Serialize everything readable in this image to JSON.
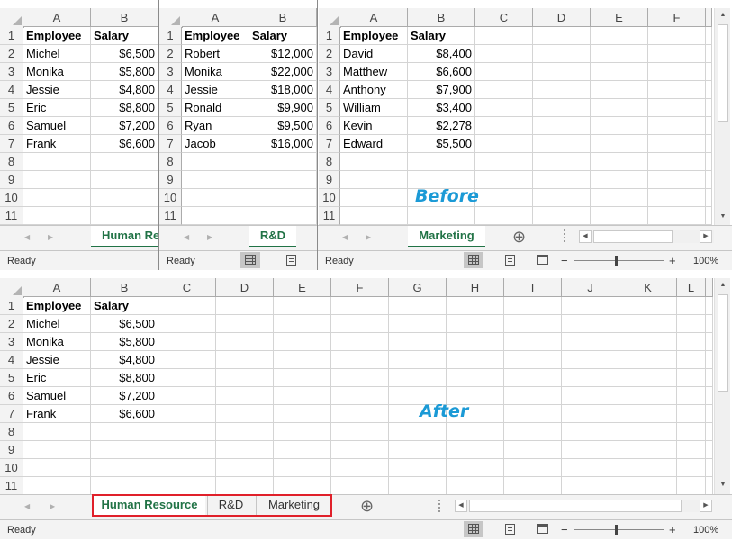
{
  "before": {
    "windows": [
      {
        "name": "human-resource",
        "columns": [
          "A",
          "B"
        ],
        "tab_label": "Human Re",
        "status": "Ready",
        "rows": [
          {
            "n": "1",
            "a": "Employee",
            "b": "Salary"
          },
          {
            "n": "2",
            "a": "Michel",
            "b": "$6,500"
          },
          {
            "n": "3",
            "a": "Monika",
            "b": "$5,800"
          },
          {
            "n": "4",
            "a": "Jessie",
            "b": "$4,800"
          },
          {
            "n": "5",
            "a": "Eric",
            "b": "$8,800"
          },
          {
            "n": "6",
            "a": "Samuel",
            "b": "$7,200"
          },
          {
            "n": "7",
            "a": "Frank",
            "b": "$6,600"
          },
          {
            "n": "8",
            "a": "",
            "b": ""
          },
          {
            "n": "9",
            "a": "",
            "b": ""
          },
          {
            "n": "10",
            "a": "",
            "b": ""
          },
          {
            "n": "11",
            "a": "",
            "b": ""
          }
        ]
      },
      {
        "name": "rd",
        "columns": [
          "A",
          "B"
        ],
        "tab_label": "R&D",
        "status": "Ready",
        "rows": [
          {
            "n": "1",
            "a": "Employee",
            "b": "Salary"
          },
          {
            "n": "2",
            "a": "Robert",
            "b": "$12,000"
          },
          {
            "n": "3",
            "a": "Monika",
            "b": "$22,000"
          },
          {
            "n": "4",
            "a": "Jessie",
            "b": "$18,000"
          },
          {
            "n": "5",
            "a": "Ronald",
            "b": "$9,900"
          },
          {
            "n": "6",
            "a": "Ryan",
            "b": "$9,500"
          },
          {
            "n": "7",
            "a": "Jacob",
            "b": "$16,000"
          },
          {
            "n": "8",
            "a": "",
            "b": ""
          },
          {
            "n": "9",
            "a": "",
            "b": ""
          },
          {
            "n": "10",
            "a": "",
            "b": ""
          },
          {
            "n": "11",
            "a": "",
            "b": ""
          }
        ]
      },
      {
        "name": "marketing",
        "columns": [
          "A",
          "B",
          "C",
          "D",
          "E",
          "F"
        ],
        "tab_label": "Marketing",
        "status": "Ready",
        "zoom": "100%",
        "rows": [
          {
            "n": "1",
            "a": "Employee",
            "b": "Salary"
          },
          {
            "n": "2",
            "a": "David",
            "b": "$8,400"
          },
          {
            "n": "3",
            "a": "Matthew",
            "b": "$6,600"
          },
          {
            "n": "4",
            "a": "Anthony",
            "b": "$7,900"
          },
          {
            "n": "5",
            "a": "William",
            "b": "$3,400"
          },
          {
            "n": "6",
            "a": "Kevin",
            "b": "$2,278"
          },
          {
            "n": "7",
            "a": "Edward",
            "b": "$5,500"
          },
          {
            "n": "8",
            "a": "",
            "b": ""
          },
          {
            "n": "9",
            "a": "",
            "b": ""
          },
          {
            "n": "10",
            "a": "",
            "b": ""
          },
          {
            "n": "11",
            "a": "",
            "b": ""
          }
        ]
      }
    ],
    "label": "Before"
  },
  "after": {
    "label": "After",
    "columns": [
      "A",
      "B",
      "C",
      "D",
      "E",
      "F",
      "G",
      "H",
      "I",
      "J",
      "K",
      "L"
    ],
    "tabs": [
      "Human Resource",
      "R&D",
      "Marketing"
    ],
    "active_tab": "Human Resource",
    "status": "Ready",
    "zoom": "100%",
    "highlight_color": "#e0202a",
    "rows": [
      {
        "n": "1",
        "a": "Employee",
        "b": "Salary"
      },
      {
        "n": "2",
        "a": "Michel",
        "b": "$6,500"
      },
      {
        "n": "3",
        "a": "Monika",
        "b": "$5,800"
      },
      {
        "n": "4",
        "a": "Jessie",
        "b": "$4,800"
      },
      {
        "n": "5",
        "a": "Eric",
        "b": "$8,800"
      },
      {
        "n": "6",
        "a": "Samuel",
        "b": "$7,200"
      },
      {
        "n": "7",
        "a": "Frank",
        "b": "$6,600"
      },
      {
        "n": "8",
        "a": "",
        "b": ""
      },
      {
        "n": "9",
        "a": "",
        "b": ""
      },
      {
        "n": "10",
        "a": "",
        "b": ""
      },
      {
        "n": "11",
        "a": "",
        "b": ""
      }
    ]
  },
  "colors": {
    "accent_green": "#217346",
    "annotation_blue": "#1b9ad6"
  },
  "icons": [
    "add-sheet-icon",
    "normal-view-icon",
    "page-layout-icon",
    "page-break-icon",
    "scroll-left-icon",
    "scroll-right-icon",
    "scroll-up-icon",
    "scroll-down-icon"
  ],
  "ui": {
    "plus": "+",
    "minus": "−",
    "add_sheet": "⊕"
  }
}
